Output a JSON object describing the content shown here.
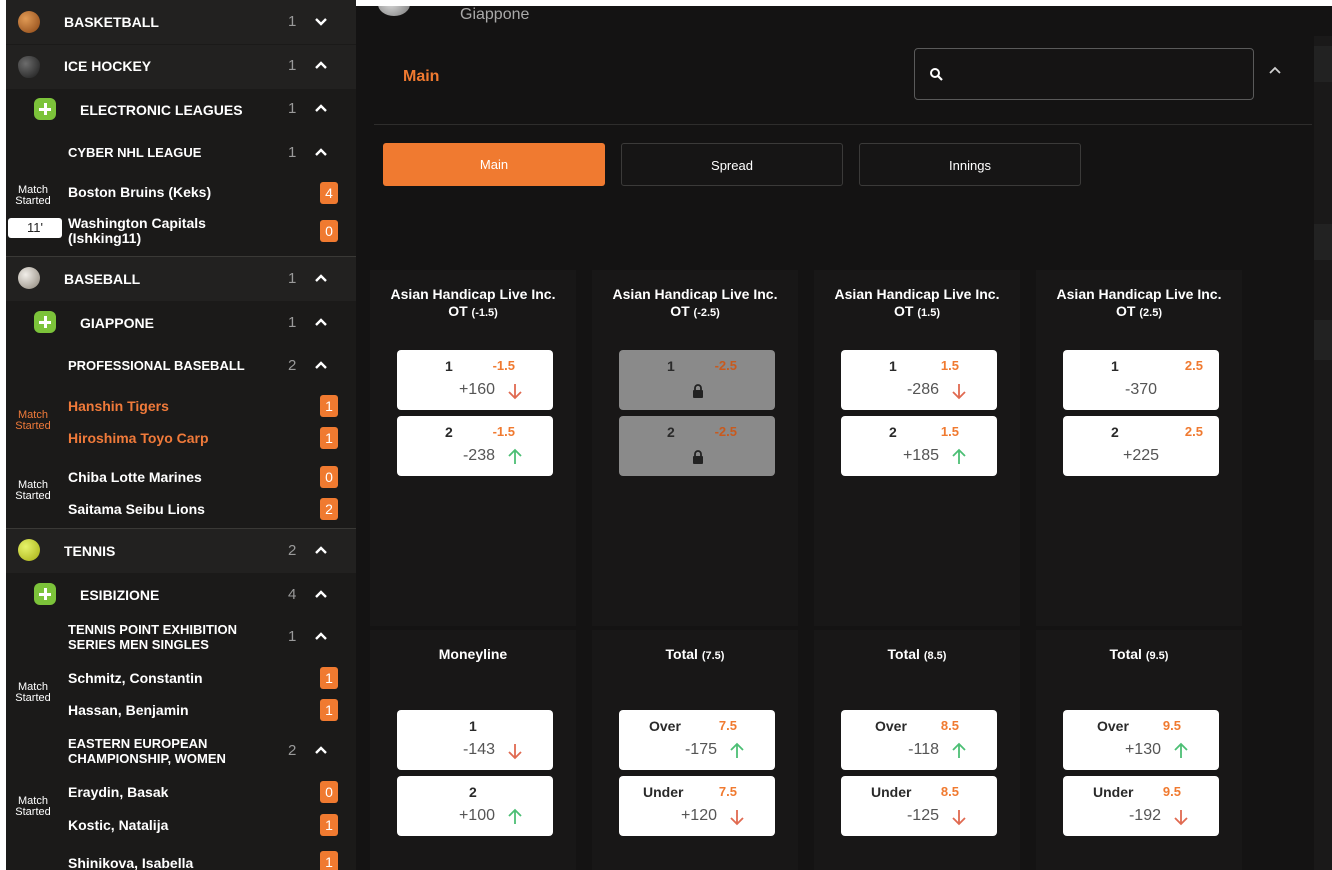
{
  "sidebar": {
    "basketball": {
      "name": "BASKETBALL",
      "count": "1"
    },
    "ice_hockey": {
      "name": "ICE HOCKEY",
      "count": "1"
    },
    "electronic_leagues": {
      "name": "ELECTRONIC LEAGUES",
      "count": "1"
    },
    "cyber_nhl": {
      "name": "CYBER NHL LEAGUE",
      "count": "1"
    },
    "hockey_match": {
      "status_line1": "Match",
      "status_line2": "Started",
      "time": "11'",
      "team1": "Boston Bruins (Keks)",
      "score1": "4",
      "team2_line1": "Washington Capitals",
      "team2_line2": "(Ishking11)",
      "score2": "0"
    },
    "baseball": {
      "name": "BASEBALL",
      "count": "1"
    },
    "giappone": {
      "name": "GIAPPONE",
      "count": "1"
    },
    "professional_baseball": {
      "name": "PROFESSIONAL BASEBALL",
      "count": "2"
    },
    "baseball_match1": {
      "status_line1": "Match",
      "status_line2": "Started",
      "team1": "Hanshin Tigers",
      "score1": "1",
      "team2": "Hiroshima Toyo Carp",
      "score2": "1"
    },
    "baseball_match2": {
      "status_line1": "Match",
      "status_line2": "Started",
      "team1": "Chiba Lotte Marines",
      "score1": "0",
      "team2": "Saitama Seibu Lions",
      "score2": "2"
    },
    "tennis": {
      "name": "TENNIS",
      "count": "2"
    },
    "esibizione": {
      "name": "ESIBIZIONE",
      "count": "4"
    },
    "tennis_point": {
      "name_line1": "TENNIS POINT EXHIBITION",
      "name_line2": "SERIES MEN SINGLES",
      "count": "1"
    },
    "tennis_match1": {
      "status_line1": "Match",
      "status_line2": "Started",
      "team1": "Schmitz, Constantin",
      "score1": "1",
      "team2": "Hassan, Benjamin",
      "score2": "1"
    },
    "eastern_european": {
      "name_line1": "EASTERN EUROPEAN",
      "name_line2": "CHAMPIONSHIP, WOMEN",
      "count": "2"
    },
    "tennis_match2": {
      "status_line1": "Match",
      "status_line2": "Started",
      "team1": "Eraydin, Basak",
      "score1": "0",
      "team2": "Kostic, Natalija",
      "score2": "1"
    },
    "tennis_match3": {
      "team1": "Shinikova, Isabella",
      "score1": "1"
    }
  },
  "header": {
    "subtitle": "Giappone",
    "section_title": "Main",
    "search_placeholder": ""
  },
  "tabs": [
    "Main",
    "Spread",
    "Innings"
  ],
  "markets_row1": [
    {
      "title": "Asian Handicap Live Inc.",
      "sub_main": "OT",
      "sub": "(-1.5)",
      "outcomes": [
        {
          "label": "1",
          "line": "-1.5",
          "price": "+160",
          "trend": "down"
        },
        {
          "label": "2",
          "line": "-1.5",
          "price": "-238",
          "trend": "up"
        }
      ]
    },
    {
      "title": "Asian Handicap Live Inc.",
      "sub_main": "OT",
      "sub": "(-2.5)",
      "locked": true,
      "outcomes": [
        {
          "label": "1",
          "line": "-2.5"
        },
        {
          "label": "2",
          "line": "-2.5"
        }
      ]
    },
    {
      "title": "Asian Handicap Live Inc.",
      "sub_main": "OT",
      "sub": "(1.5)",
      "outcomes": [
        {
          "label": "1",
          "line": "1.5",
          "price": "-286",
          "trend": "down"
        },
        {
          "label": "2",
          "line": "1.5",
          "price": "+185",
          "trend": "up"
        }
      ]
    },
    {
      "title": "Asian Handicap Live Inc.",
      "sub_main": "OT",
      "sub": "(2.5)",
      "outcomes": [
        {
          "label": "1",
          "line": "2.5",
          "price": "-370",
          "trend": "none"
        },
        {
          "label": "2",
          "line": "2.5",
          "price": "+225",
          "trend": "none"
        }
      ]
    }
  ],
  "markets_row2": [
    {
      "title": "Moneyline",
      "sub": "",
      "outcomes": [
        {
          "label": "1",
          "line": "",
          "price": "-143",
          "trend": "down"
        },
        {
          "label": "2",
          "line": "",
          "price": "+100",
          "trend": "up"
        }
      ]
    },
    {
      "title": "Total",
      "sub": "(7.5)",
      "outcomes": [
        {
          "label": "Over",
          "line": "7.5",
          "price": "-175",
          "trend": "up"
        },
        {
          "label": "Under",
          "line": "7.5",
          "price": "+120",
          "trend": "down"
        }
      ]
    },
    {
      "title": "Total",
      "sub": "(8.5)",
      "outcomes": [
        {
          "label": "Over",
          "line": "8.5",
          "price": "-118",
          "trend": "up"
        },
        {
          "label": "Under",
          "line": "8.5",
          "price": "-125",
          "trend": "down"
        }
      ]
    },
    {
      "title": "Total",
      "sub": "(9.5)",
      "outcomes": [
        {
          "label": "Over",
          "line": "9.5",
          "price": "+130",
          "trend": "up"
        },
        {
          "label": "Under",
          "line": "9.5",
          "price": "-192",
          "trend": "down"
        }
      ]
    }
  ],
  "colors": {
    "accent": "#f07a30",
    "up": "#4cbf74",
    "down": "#e06a50",
    "panel": "#141313",
    "sidebar": "#1b1a19"
  }
}
